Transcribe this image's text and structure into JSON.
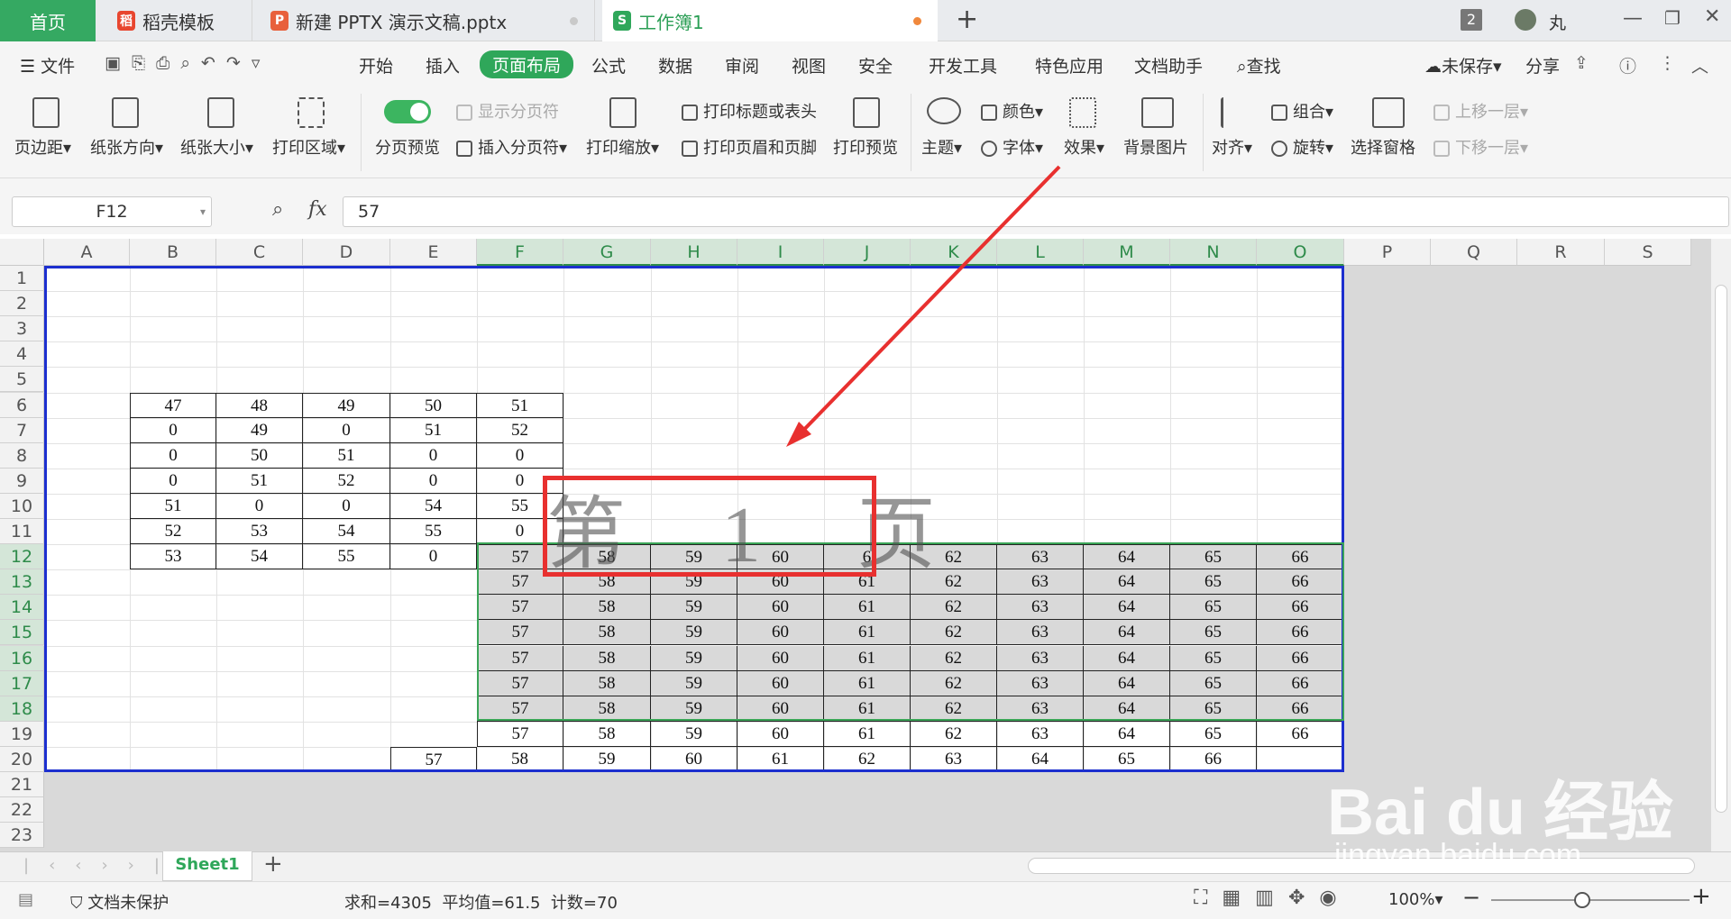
{
  "tabs": {
    "home": "首页",
    "t2": "稻壳模板",
    "t3": "新建 PPTX 演示文稿.pptx",
    "t4": "工作簿1",
    "plus": "+",
    "count": "2",
    "user": "丸"
  },
  "menu": {
    "file": "文件",
    "items": [
      "开始",
      "插入",
      "页面布局",
      "公式",
      "数据",
      "审阅",
      "视图",
      "安全",
      "开发工具",
      "特色应用",
      "文档助手"
    ],
    "search": "查找",
    "unsaved": "未保存",
    "share": "分享"
  },
  "ribbon": {
    "margin": "页边距",
    "orientation": "纸张方向",
    "size": "纸张大小",
    "print_area": "打印区域",
    "page_break_preview": "分页预览",
    "show_breaks": "显示分页符",
    "insert_break": "插入分页符",
    "print_scale": "打印缩放",
    "print_titles": "打印标题或表头",
    "print_header_footer": "打印页眉和页脚",
    "print_preview": "打印预览",
    "theme": "主题",
    "colors": "颜色",
    "fonts": "字体",
    "effects": "效果",
    "background": "背景图片",
    "align": "对齐",
    "group": "组合",
    "rotate": "旋转",
    "selection_pane": "选择窗格",
    "bring_forward": "上移一层",
    "send_backward": "下移一层"
  },
  "formula": {
    "cell": "F12",
    "fx": "fx",
    "value": "57"
  },
  "columns": [
    "A",
    "B",
    "C",
    "D",
    "E",
    "F",
    "G",
    "H",
    "I",
    "J",
    "K",
    "L",
    "M",
    "N",
    "O",
    "P",
    "Q",
    "R",
    "S"
  ],
  "rows": [
    "1",
    "2",
    "3",
    "4",
    "5",
    "6",
    "7",
    "8",
    "9",
    "10",
    "11",
    "12",
    "13",
    "14",
    "15",
    "16",
    "17",
    "18",
    "19",
    "20",
    "21",
    "22",
    "23"
  ],
  "table_left": {
    "rows": [
      [
        "47",
        "48",
        "49",
        "50",
        "51"
      ],
      [
        "0",
        "49",
        "0",
        "51",
        "52"
      ],
      [
        "0",
        "50",
        "51",
        "0",
        "0"
      ],
      [
        "0",
        "51",
        "52",
        "0",
        "0"
      ],
      [
        "51",
        "0",
        "0",
        "54",
        "55"
      ],
      [
        "52",
        "53",
        "54",
        "55",
        "0"
      ],
      [
        "53",
        "54",
        "55",
        "0",
        ""
      ]
    ]
  },
  "table_right": {
    "rows": [
      [
        "57",
        "58",
        "59",
        "60",
        "6",
        "62",
        "63",
        "64",
        "65",
        "66"
      ],
      [
        "57",
        "58",
        "59",
        "60",
        "61",
        "62",
        "63",
        "64",
        "65",
        "66"
      ],
      [
        "57",
        "58",
        "59",
        "60",
        "61",
        "62",
        "63",
        "64",
        "65",
        "66"
      ],
      [
        "57",
        "58",
        "59",
        "60",
        "61",
        "62",
        "63",
        "64",
        "65",
        "66"
      ],
      [
        "57",
        "58",
        "59",
        "60",
        "61",
        "62",
        "63",
        "64",
        "65",
        "66"
      ],
      [
        "57",
        "58",
        "59",
        "60",
        "61",
        "62",
        "63",
        "64",
        "65",
        "66"
      ],
      [
        "57",
        "58",
        "59",
        "60",
        "61",
        "62",
        "63",
        "64",
        "65",
        "66"
      ],
      [
        "57",
        "58",
        "59",
        "60",
        "61",
        "62",
        "63",
        "64",
        "65",
        "66"
      ]
    ],
    "row20": [
      "57",
      "58",
      "59",
      "60",
      "61",
      "62",
      "63",
      "64",
      "65",
      "66"
    ]
  },
  "watermark": "第 1 页",
  "sheet": {
    "name": "Sheet1",
    "add": "+"
  },
  "status": {
    "protect": "文档未保护",
    "stats": "求和=4305  平均值=61.5  计数=70",
    "zoom": "100%"
  },
  "baidu": {
    "logo": "Bai du 经验",
    "url": "jingyan.baidu.com"
  },
  "colors": {
    "green": "#2fa75a",
    "blue_border": "#1c2fcf",
    "red": "#e8302f",
    "selection": "#d9d9d9"
  }
}
